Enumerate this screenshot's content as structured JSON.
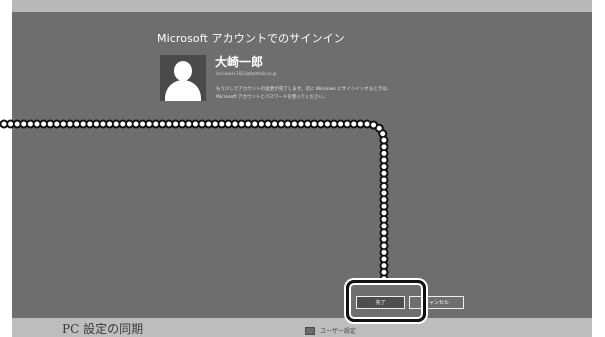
{
  "background_screen": {
    "title": "PC 設定の同期",
    "item_label": "ユーザー設定"
  },
  "dialog": {
    "title": "Microsoft アカウントでのサインイン",
    "user_name": "大崎一郎",
    "user_email": "ichi-osaki-1923@hotmail.co.jp",
    "message_line1": "もう少しでアカウントの変更が完了します。次に Windows にサインインするときは、",
    "message_line2": "Microsoft アカウントとパスワードを使ってください。",
    "finish_label": "完了",
    "cancel_label": "キャンセル"
  },
  "colors": {
    "dialog_background": "#6e6e6e",
    "callout": "#111111"
  },
  "icons": {
    "avatar": "user-silhouette-icon"
  }
}
